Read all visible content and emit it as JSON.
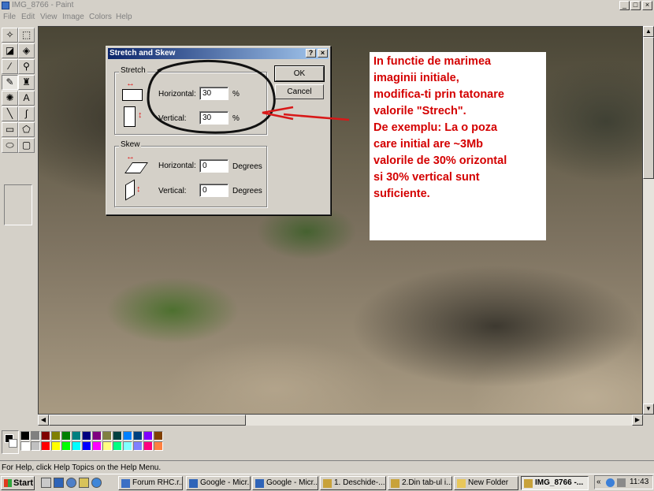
{
  "window": {
    "title": "IMG_8766 - Paint",
    "controls": {
      "minimize": "_",
      "maximize": "□",
      "close": "×"
    }
  },
  "menu": [
    "File",
    "Edit",
    "View",
    "Image",
    "Colors",
    "Help"
  ],
  "toolbox": {
    "tools": [
      {
        "name": "free-form-select-icon",
        "glyph": "✧"
      },
      {
        "name": "select-icon",
        "glyph": "⬚"
      },
      {
        "name": "eraser-icon",
        "glyph": "◪"
      },
      {
        "name": "fill-icon",
        "glyph": "◈"
      },
      {
        "name": "pick-color-icon",
        "glyph": "⁄"
      },
      {
        "name": "magnifier-icon",
        "glyph": "⚲"
      },
      {
        "name": "pencil-icon",
        "glyph": "✎"
      },
      {
        "name": "brush-icon",
        "glyph": "♜"
      },
      {
        "name": "airbrush-icon",
        "glyph": "✺"
      },
      {
        "name": "text-icon",
        "glyph": "A"
      },
      {
        "name": "line-icon",
        "glyph": "╲"
      },
      {
        "name": "curve-icon",
        "glyph": "∫"
      },
      {
        "name": "rectangle-icon",
        "glyph": "▭"
      },
      {
        "name": "polygon-icon",
        "glyph": "⬠"
      },
      {
        "name": "ellipse-icon",
        "glyph": "⬭"
      },
      {
        "name": "rounded-rectangle-icon",
        "glyph": "▢"
      }
    ]
  },
  "palette": {
    "top_row": [
      "#000000",
      "#808080",
      "#800000",
      "#808000",
      "#008000",
      "#008080",
      "#000080",
      "#800080",
      "#808040",
      "#004040",
      "#0080ff",
      "#004080",
      "#8000ff",
      "#804000"
    ],
    "bottom_row": [
      "#ffffff",
      "#c0c0c0",
      "#ff0000",
      "#ffff00",
      "#00ff00",
      "#00ffff",
      "#0000ff",
      "#ff00ff",
      "#ffff80",
      "#00ff80",
      "#80ffff",
      "#8080ff",
      "#ff0080",
      "#ff8040"
    ]
  },
  "status_text": "For Help, click Help Topics on the Help Menu.",
  "dialog": {
    "title": "Stretch and Skew",
    "help_glyph": "?",
    "close_glyph": "×",
    "stretch": {
      "label": "Stretch",
      "horizontal_label": "Horizontal:",
      "horizontal_value": "30",
      "vertical_label": "Vertical:",
      "vertical_value": "30",
      "unit": "%"
    },
    "skew": {
      "label": "Skew",
      "horizontal_label": "Horizontal:",
      "horizontal_value": "0",
      "vertical_label": "Vertical:",
      "vertical_value": "0",
      "unit": "Degrees"
    },
    "ok_label": "OK",
    "cancel_label": "Cancel"
  },
  "annotation": {
    "text": "In functie de marimea\nimaginii initiale,\nmodifica-ti prin tatonare\nvalorile \"Strech\".\n De exemplu: La o poza\ncare initial are ~3Mb\nvalorile de 30% orizontal\nsi 30% vertical sunt\nsuficiente."
  },
  "taskbar": {
    "start_label": "Start",
    "tasks": [
      {
        "label": "Forum RHC.r...",
        "icon_color": "#3b6fc4",
        "active": false
      },
      {
        "label": "Google - Micr...",
        "icon_color": "#2f64b8",
        "active": false
      },
      {
        "label": "Google - Micr...",
        "icon_color": "#2f64b8",
        "active": false
      },
      {
        "label": "1. Deschide-...",
        "icon_color": "#c8a23a",
        "active": false
      },
      {
        "label": "2.Din tab-ul i...",
        "icon_color": "#c8a23a",
        "active": false
      },
      {
        "label": "New Folder",
        "icon_color": "#e8c75a",
        "active": false
      },
      {
        "label": "IMG_8766 -...",
        "icon_color": "#c8a23a",
        "active": true
      }
    ],
    "clock": "11:43",
    "tray_chevron": "«"
  },
  "accent": {
    "dialog_title": "#0a246a",
    "annotation_text": "#d40000",
    "marker": "#111111",
    "arrow": "#d81818"
  }
}
